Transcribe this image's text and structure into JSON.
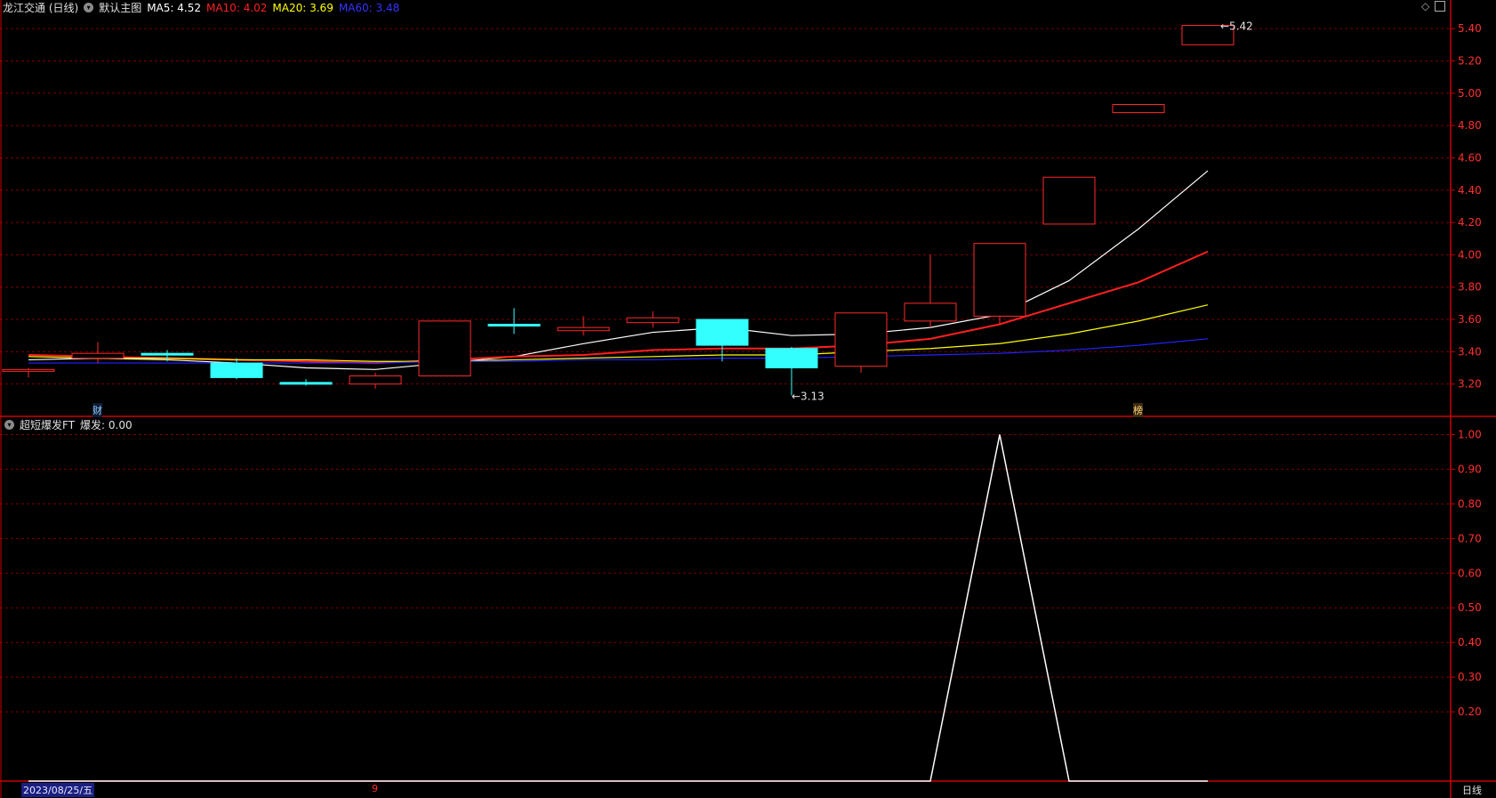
{
  "window": {
    "title": "龙江交通 (日线)",
    "main_chart_label": "默认主图",
    "period_label": "日线",
    "start_date": "2023/08/25/五",
    "bottom_marker": "9",
    "corner_icons": [
      "diamond-icon",
      "panel-toggle-icon"
    ]
  },
  "colors": {
    "up": "#ff2a2a",
    "down": "#33ffff",
    "ma5": "#ffffff",
    "ma10": "#ff2020",
    "ma20": "#ffff00",
    "ma60": "#2222ff",
    "axis": "#cc0000",
    "grid": "#7a0000"
  },
  "chart_data": [
    {
      "type": "candlestick",
      "panel": "main",
      "title": "",
      "ylim": [
        3.0,
        5.5
      ],
      "yticks": [
        3.2,
        3.4,
        3.6,
        3.8,
        4.0,
        4.2,
        4.4,
        4.6,
        4.8,
        5.0,
        5.2,
        5.4
      ],
      "grid": true,
      "candles": [
        {
          "o": 3.29,
          "h": 3.3,
          "l": 3.24,
          "c": 3.29
        },
        {
          "o": 3.36,
          "h": 3.46,
          "l": 3.33,
          "c": 3.39
        },
        {
          "o": 3.39,
          "h": 3.41,
          "l": 3.34,
          "c": 3.38
        },
        {
          "o": 3.33,
          "h": 3.36,
          "l": 3.23,
          "c": 3.24
        },
        {
          "o": 3.21,
          "h": 3.23,
          "l": 3.19,
          "c": 3.2
        },
        {
          "o": 3.2,
          "h": 3.27,
          "l": 3.17,
          "c": 3.25
        },
        {
          "o": 3.25,
          "h": 3.59,
          "l": 3.25,
          "c": 3.59
        },
        {
          "o": 3.57,
          "h": 3.67,
          "l": 3.51,
          "c": 3.56
        },
        {
          "o": 3.53,
          "h": 3.62,
          "l": 3.5,
          "c": 3.55
        },
        {
          "o": 3.58,
          "h": 3.65,
          "l": 3.55,
          "c": 3.61
        },
        {
          "o": 3.6,
          "h": 3.6,
          "l": 3.34,
          "c": 3.44
        },
        {
          "o": 3.42,
          "h": 3.43,
          "l": 3.13,
          "c": 3.3
        },
        {
          "o": 3.31,
          "h": 3.64,
          "l": 3.27,
          "c": 3.64
        },
        {
          "o": 3.59,
          "h": 4.0,
          "l": 3.55,
          "c": 3.7
        },
        {
          "o": 3.62,
          "h": 4.07,
          "l": 3.57,
          "c": 4.07
        },
        {
          "o": 4.19,
          "h": 4.48,
          "l": 4.19,
          "c": 4.48
        },
        {
          "o": 4.88,
          "h": 4.93,
          "l": 4.88,
          "c": 4.93
        },
        {
          "o": 5.3,
          "h": 5.42,
          "l": 5.3,
          "c": 5.42
        }
      ],
      "series": [
        {
          "name": "MA5",
          "color": "#ffffff",
          "label_value": "4.52",
          "values": [
            3.35,
            3.36,
            3.35,
            3.33,
            3.3,
            3.29,
            3.33,
            3.37,
            3.45,
            3.52,
            3.55,
            3.5,
            3.51,
            3.55,
            3.63,
            3.84,
            4.16,
            4.52
          ]
        },
        {
          "name": "MA10",
          "color": "#ff2020",
          "label_value": "4.02",
          "values": [
            3.38,
            3.37,
            3.36,
            3.35,
            3.34,
            3.33,
            3.35,
            3.37,
            3.38,
            3.41,
            3.42,
            3.42,
            3.44,
            3.48,
            3.57,
            3.7,
            3.83,
            4.02
          ]
        },
        {
          "name": "MA20",
          "color": "#ffff00",
          "label_value": "3.69",
          "values": [
            3.37,
            3.36,
            3.36,
            3.35,
            3.35,
            3.34,
            3.34,
            3.35,
            3.36,
            3.37,
            3.38,
            3.38,
            3.4,
            3.42,
            3.45,
            3.51,
            3.59,
            3.69
          ]
        },
        {
          "name": "MA60",
          "color": "#2222ff",
          "label_value": "3.48",
          "values": [
            3.33,
            3.33,
            3.33,
            3.33,
            3.33,
            3.33,
            3.34,
            3.34,
            3.35,
            3.35,
            3.36,
            3.36,
            3.37,
            3.38,
            3.39,
            3.41,
            3.44,
            3.48
          ]
        }
      ],
      "annotations": [
        {
          "label": "3.13",
          "candle": 11,
          "value": 3.13
        },
        {
          "label": "5.42",
          "candle": 17,
          "value": 5.42
        }
      ],
      "markers": [
        {
          "label": "财",
          "candle": 1
        },
        {
          "label": "榜",
          "candle": 16
        }
      ]
    },
    {
      "type": "line",
      "panel": "indicator",
      "title": "超短爆发FT",
      "series_label": "爆发: 0.00",
      "ylim": [
        0.0,
        1.05
      ],
      "yticks": [
        0.2,
        0.3,
        0.4,
        0.5,
        0.6,
        0.7,
        0.8,
        0.9,
        1.0
      ],
      "grid": true,
      "x": [
        0,
        13,
        14,
        15,
        17
      ],
      "series": [
        {
          "name": "爆发",
          "color": "#ffffff",
          "values": [
            0,
            0,
            1,
            0,
            0
          ]
        }
      ]
    }
  ]
}
